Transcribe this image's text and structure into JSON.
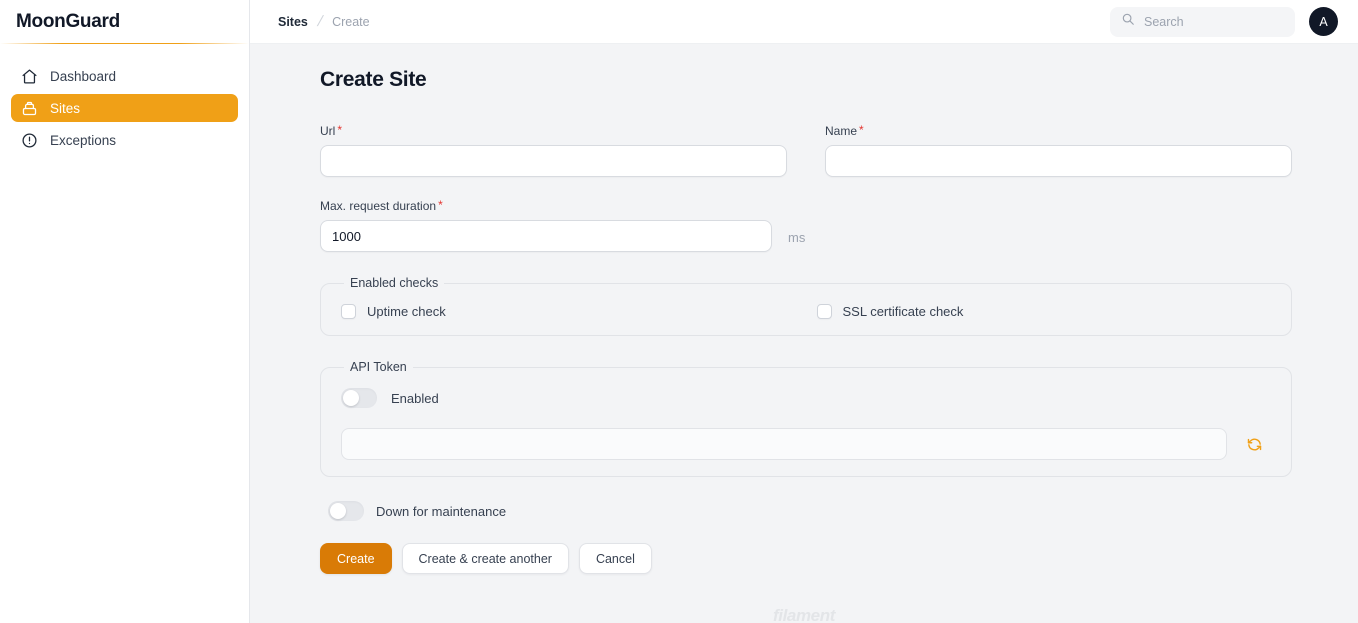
{
  "brand": {
    "name": "MoonGuard"
  },
  "sidebar": {
    "items": [
      {
        "label": "Dashboard",
        "icon": "home-icon",
        "active": false
      },
      {
        "label": "Sites",
        "icon": "server-icon",
        "active": true
      },
      {
        "label": "Exceptions",
        "icon": "alert-circle-icon",
        "active": false
      }
    ]
  },
  "topbar": {
    "breadcrumb": {
      "parent": "Sites",
      "separator": "/",
      "current": "Create"
    },
    "search": {
      "placeholder": "Search",
      "value": "",
      "icon": "search-icon"
    },
    "avatar": {
      "initial": "A"
    }
  },
  "page": {
    "title": "Create Site",
    "required_marker": "*",
    "fields": {
      "url": {
        "label": "Url",
        "value": "",
        "placeholder": "",
        "required": true
      },
      "name": {
        "label": "Name",
        "value": "",
        "placeholder": "",
        "required": true
      },
      "max_request_duration": {
        "label": "Max. request duration",
        "value": "1000",
        "placeholder": "",
        "suffix": "ms",
        "required": true
      }
    },
    "enabled_checks": {
      "legend": "Enabled checks",
      "items": [
        {
          "label": "Uptime check",
          "checked": false
        },
        {
          "label": "SSL certificate check",
          "checked": false
        }
      ]
    },
    "api_token": {
      "legend": "API Token",
      "toggle_label": "Enabled",
      "toggle_on": false,
      "token_value": "",
      "token_placeholder": "",
      "refresh_icon": "refresh-icon"
    },
    "maintenance": {
      "label": "Down for maintenance",
      "toggle_on": false
    },
    "actions": {
      "create": "Create",
      "create_another": "Create & create another",
      "cancel": "Cancel"
    }
  },
  "watermark": {
    "text": "filament"
  },
  "colors": {
    "accent": "#f0a017",
    "primary_button": "#d97b06",
    "required": "#e3342f",
    "page_background": "#f3f4f6",
    "surface": "#ffffff"
  }
}
